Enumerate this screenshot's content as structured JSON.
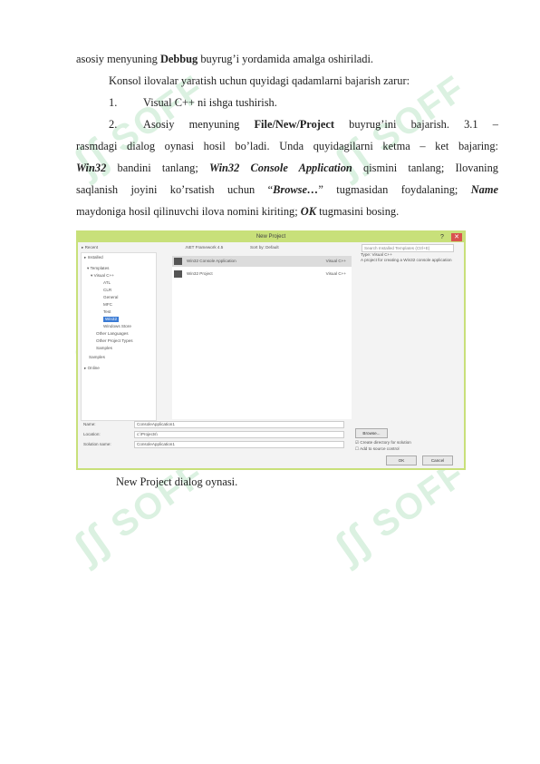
{
  "text": {
    "l1_pre": "asosiy menyuning ",
    "l1_bold": "Debbug",
    "l1_post": " buyrug’i yordamida amalga oshiriladi.",
    "l2": "Konsol ilovalar yaratish uchun quyidagi qadamlarni bajarish zarur:",
    "l3_num": "1.",
    "l3": "Visual C++ ni ishga tushirish.",
    "l4_num": "2.",
    "l4_a": "Asosiy",
    "l4_b": "menyuning",
    "l4_c": "File/New/Project",
    "l4_d": "buyrug’ini",
    "l4_e": "bajarish.",
    "l4_f": "3.1",
    "l4_g": "–",
    "l5": "rasmdagi dialog oynasi hosil bo’ladi. Unda quyidagilarni ketma – ket bajaring:",
    "l6_a": "Win32",
    "l6_b": " bandini tanlang; ",
    "l6_c": "Win32 Console Application",
    "l6_d": " qismini tanlang; Ilovaning",
    "l7_a": "saqlanish joyini ko’rsatish uchun “",
    "l7_b": "Browse…",
    "l7_c": "” tugmasidan foydalaning; ",
    "l7_d": "Name",
    "l8_a": "maydoniga hosil qilinuvchi ilova nomini kiriting; ",
    "l8_b": "OK",
    "l8_c": " tugmasini bosing.",
    "caption": "New Project dialog oynasi."
  },
  "watermark": {
    "brand": "SOFF",
    "letters": "ʃʃ"
  },
  "dialog": {
    "title": "New Project",
    "min": "?",
    "close": "✕",
    "recent": "▸ Recent",
    "installed": "▸ Installed",
    "online": "▸ Online",
    "sort_label": ".NET Framework 4.5",
    "sort_by": "Sort by: Default",
    "search_placeholder": "Search Installed Templates (Ctrl+E)",
    "tree": [
      "▾ Templates",
      "▾ Visual C++",
      "ATL",
      "CLR",
      "General",
      "MFC",
      "Test",
      "Win32",
      "Windows Store",
      "Other Languages",
      "Other Project Types",
      "Samples"
    ],
    "templates": [
      {
        "name": "Win32 Console Application",
        "lang": "Visual C++"
      },
      {
        "name": "Win32 Project",
        "lang": "Visual C++"
      }
    ],
    "type_label": "Type: Visual C++",
    "desc": "A project for creating a Win32 console application",
    "name_label": "Name:",
    "name_value": "ConsoleApplication1",
    "location_label": "Location:",
    "location_value": "c:\\Projects\\",
    "solution_label": "Solution name:",
    "solution_value": "ConsoleApplication1",
    "browse": "Browse...",
    "create_dir": "Create directory for solution",
    "add_source": "Add to source control",
    "ok": "OK",
    "cancel": "Cancel"
  }
}
